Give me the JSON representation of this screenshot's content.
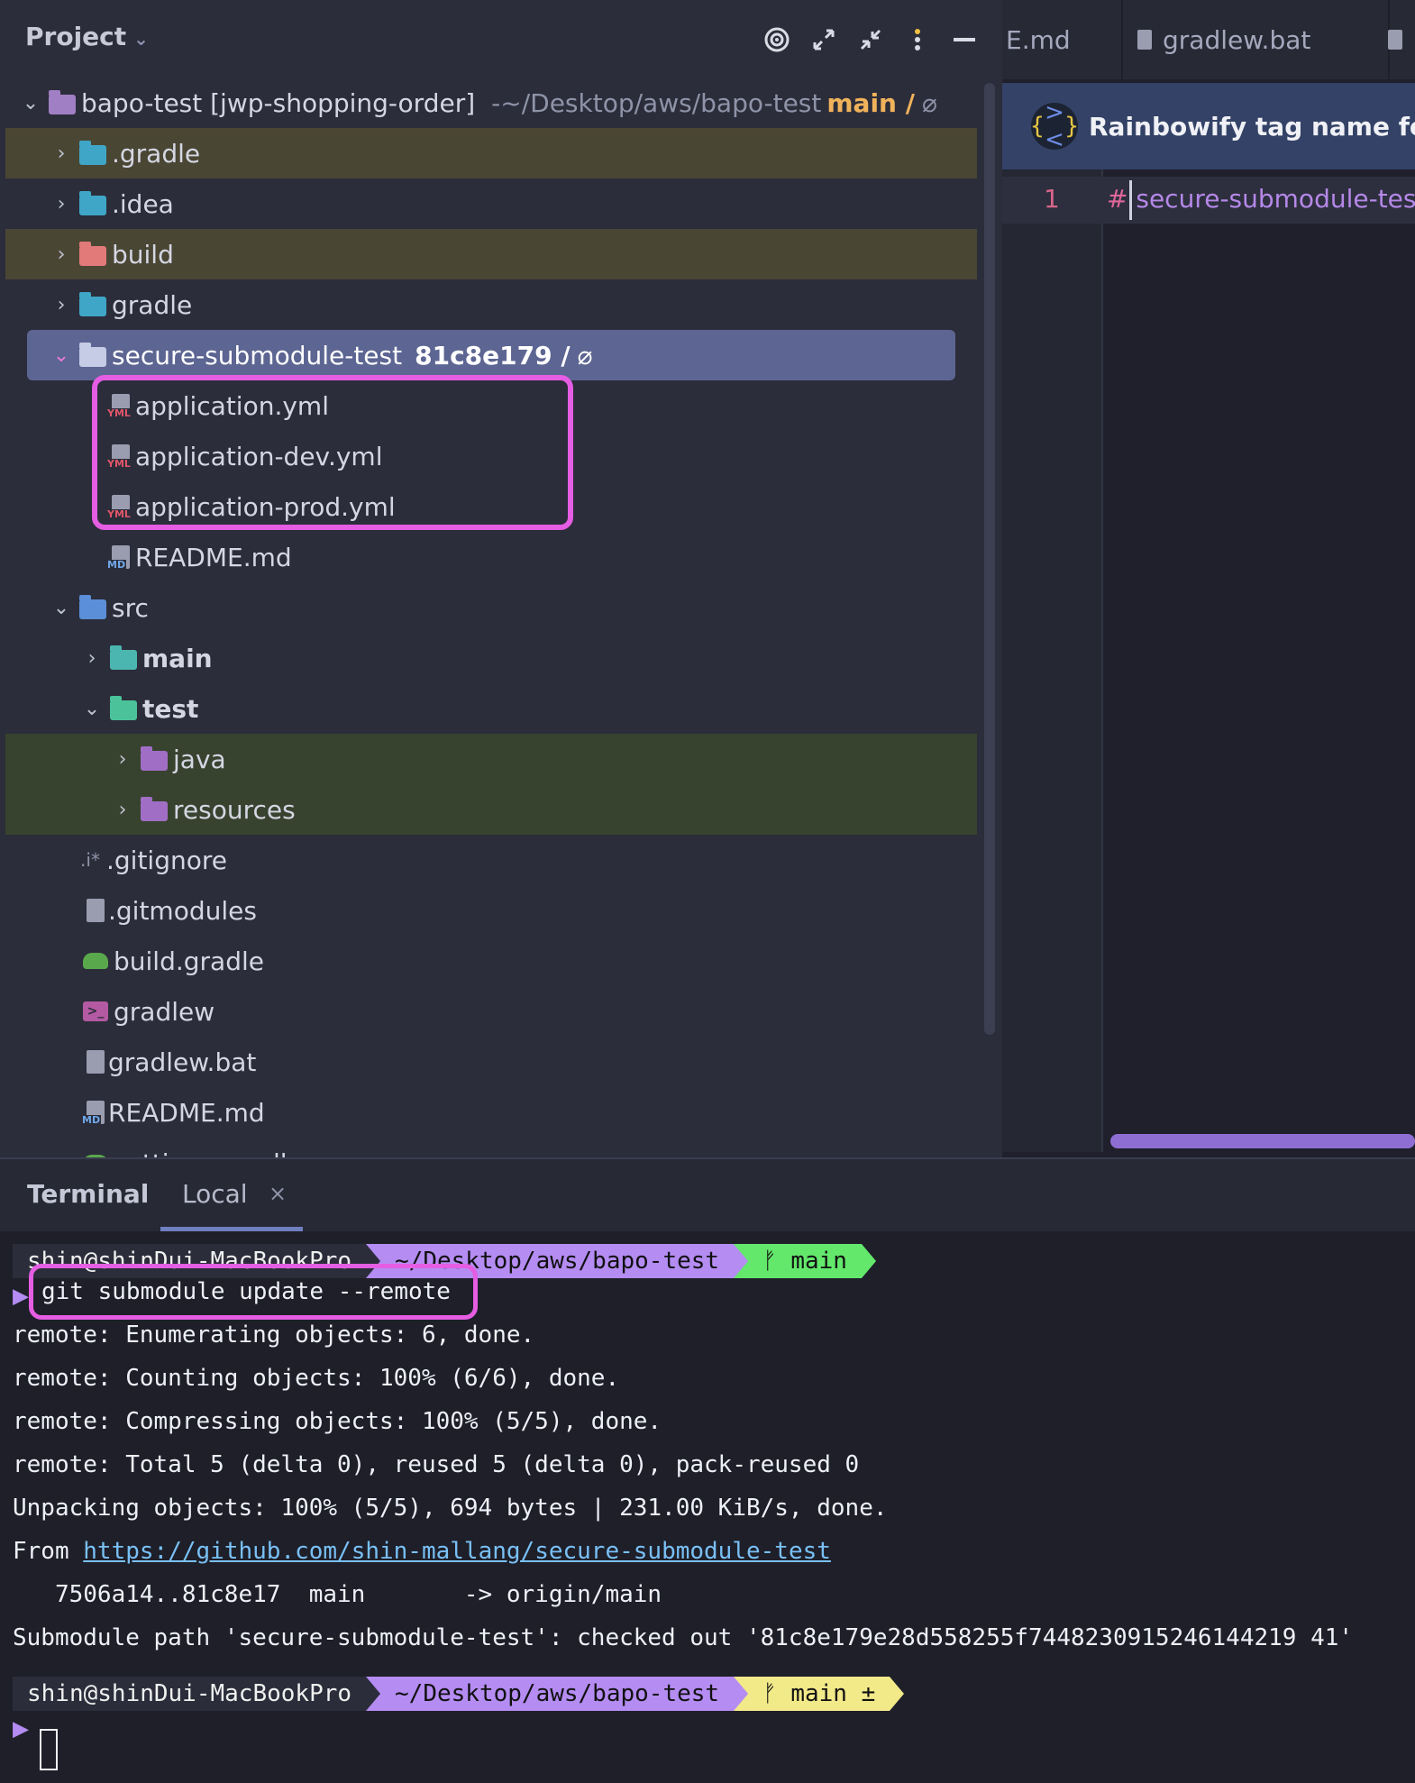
{
  "project": {
    "title": "Project",
    "tree": [
      {
        "label": "bapo-test [jwp-shopping-order]",
        "extra": "~/Desktop/aws/bapo-test",
        "branch": "main /",
        "icon": "module-folder-icon"
      },
      {
        "label": ".gradle",
        "icon": "gradle-folder-icon"
      },
      {
        "label": ".idea",
        "icon": "idea-folder-icon"
      },
      {
        "label": "build",
        "icon": "build-folder-icon"
      },
      {
        "label": "gradle",
        "icon": "gradle-folder-icon"
      },
      {
        "label": "secure-submodule-test",
        "commit": "81c8e179 /",
        "icon": "folder-icon"
      },
      {
        "label": "application.yml",
        "icon": "yml-file-icon"
      },
      {
        "label": "application-dev.yml",
        "icon": "yml-file-icon"
      },
      {
        "label": "application-prod.yml",
        "icon": "yml-file-icon"
      },
      {
        "label": "README.md",
        "icon": "markdown-file-icon"
      },
      {
        "label": "src",
        "icon": "source-folder-icon"
      },
      {
        "label": "main",
        "icon": "main-folder-icon"
      },
      {
        "label": "test",
        "icon": "test-folder-icon"
      },
      {
        "label": "java",
        "icon": "java-folder-icon"
      },
      {
        "label": "resources",
        "icon": "resources-folder-icon"
      },
      {
        "label": ".gitignore",
        "icon": "gitignore-icon"
      },
      {
        "label": ".gitmodules",
        "icon": "text-file-icon"
      },
      {
        "label": "build.gradle",
        "icon": "gradle-file-icon"
      },
      {
        "label": "gradlew",
        "icon": "shell-file-icon"
      },
      {
        "label": "gradlew.bat",
        "icon": "text-file-icon"
      },
      {
        "label": "README.md",
        "icon": "markdown-file-icon"
      },
      {
        "label": "settings.gradle",
        "icon": "gradle-file-icon"
      }
    ]
  },
  "editor": {
    "tabs": [
      "E.md",
      "gradlew.bat"
    ],
    "banner": "Rainbowify tag name for",
    "line_number": "1",
    "line_hash": "#",
    "line_text": " secure-submodule-test"
  },
  "terminal": {
    "title": "Terminal",
    "tab": "Local",
    "prompt1": {
      "user": "shin@shinDui-MacBookPro",
      "path": "~/Desktop/aws/bapo-test",
      "git": "main"
    },
    "command": "git submodule update --remote",
    "output": [
      "remote: Enumerating objects: 6, done.",
      "remote: Counting objects: 100% (6/6), done.",
      "remote: Compressing objects: 100% (5/5), done.",
      "remote: Total 5 (delta 0), reused 5 (delta 0), pack-reused 0",
      "Unpacking objects: 100% (5/5), 694 bytes | 231.00 KiB/s, done."
    ],
    "from_prefix": "From ",
    "from_url": "https://github.com/shin-mallang/secure-submodule-test",
    "ref_line": "   7506a14..81c8e17  main       -> origin/main",
    "checkout_line": "Submodule path 'secure-submodule-test': checked out '81c8e179e28d558255f7448230915246144219 41'",
    "prompt2": {
      "user": "shin@shinDui-MacBookPro",
      "path": "~/Desktop/aws/bapo-test",
      "git": "main ±"
    }
  },
  "colors": {
    "highlight_box": "#e45de2",
    "selected_row": "#5d6592",
    "path_segment": "#b48cf2",
    "git_clean": "#63e86c",
    "git_dirty": "#f2e989"
  }
}
